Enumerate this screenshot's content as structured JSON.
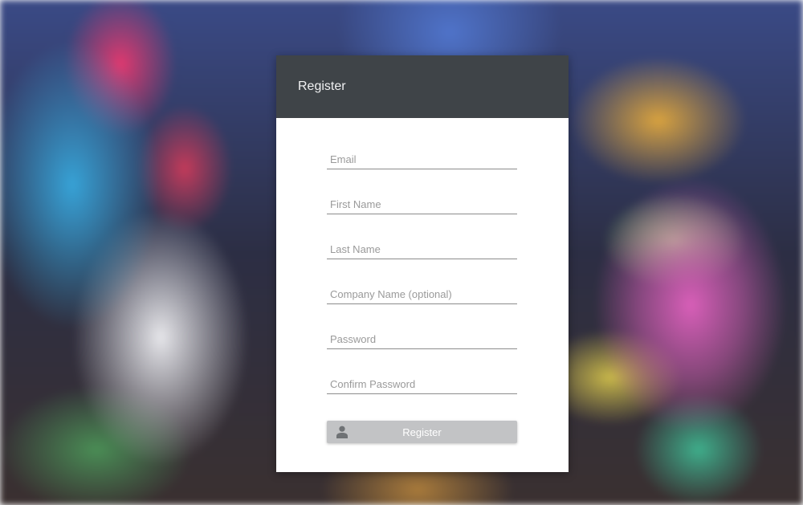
{
  "card": {
    "title": "Register"
  },
  "form": {
    "fields": [
      {
        "placeholder": "Email",
        "value": ""
      },
      {
        "placeholder": "First Name",
        "value": ""
      },
      {
        "placeholder": "Last Name",
        "value": ""
      },
      {
        "placeholder": "Company Name (optional)",
        "value": ""
      },
      {
        "placeholder": "Password",
        "value": ""
      },
      {
        "placeholder": "Confirm Password",
        "value": ""
      }
    ],
    "submit_label": "Register",
    "submit_icon": "user-icon"
  },
  "colors": {
    "header_bg": "#3f4448",
    "card_bg": "#ffffff",
    "button_bg": "#c2c3c5",
    "placeholder": "#9a9a9a"
  }
}
